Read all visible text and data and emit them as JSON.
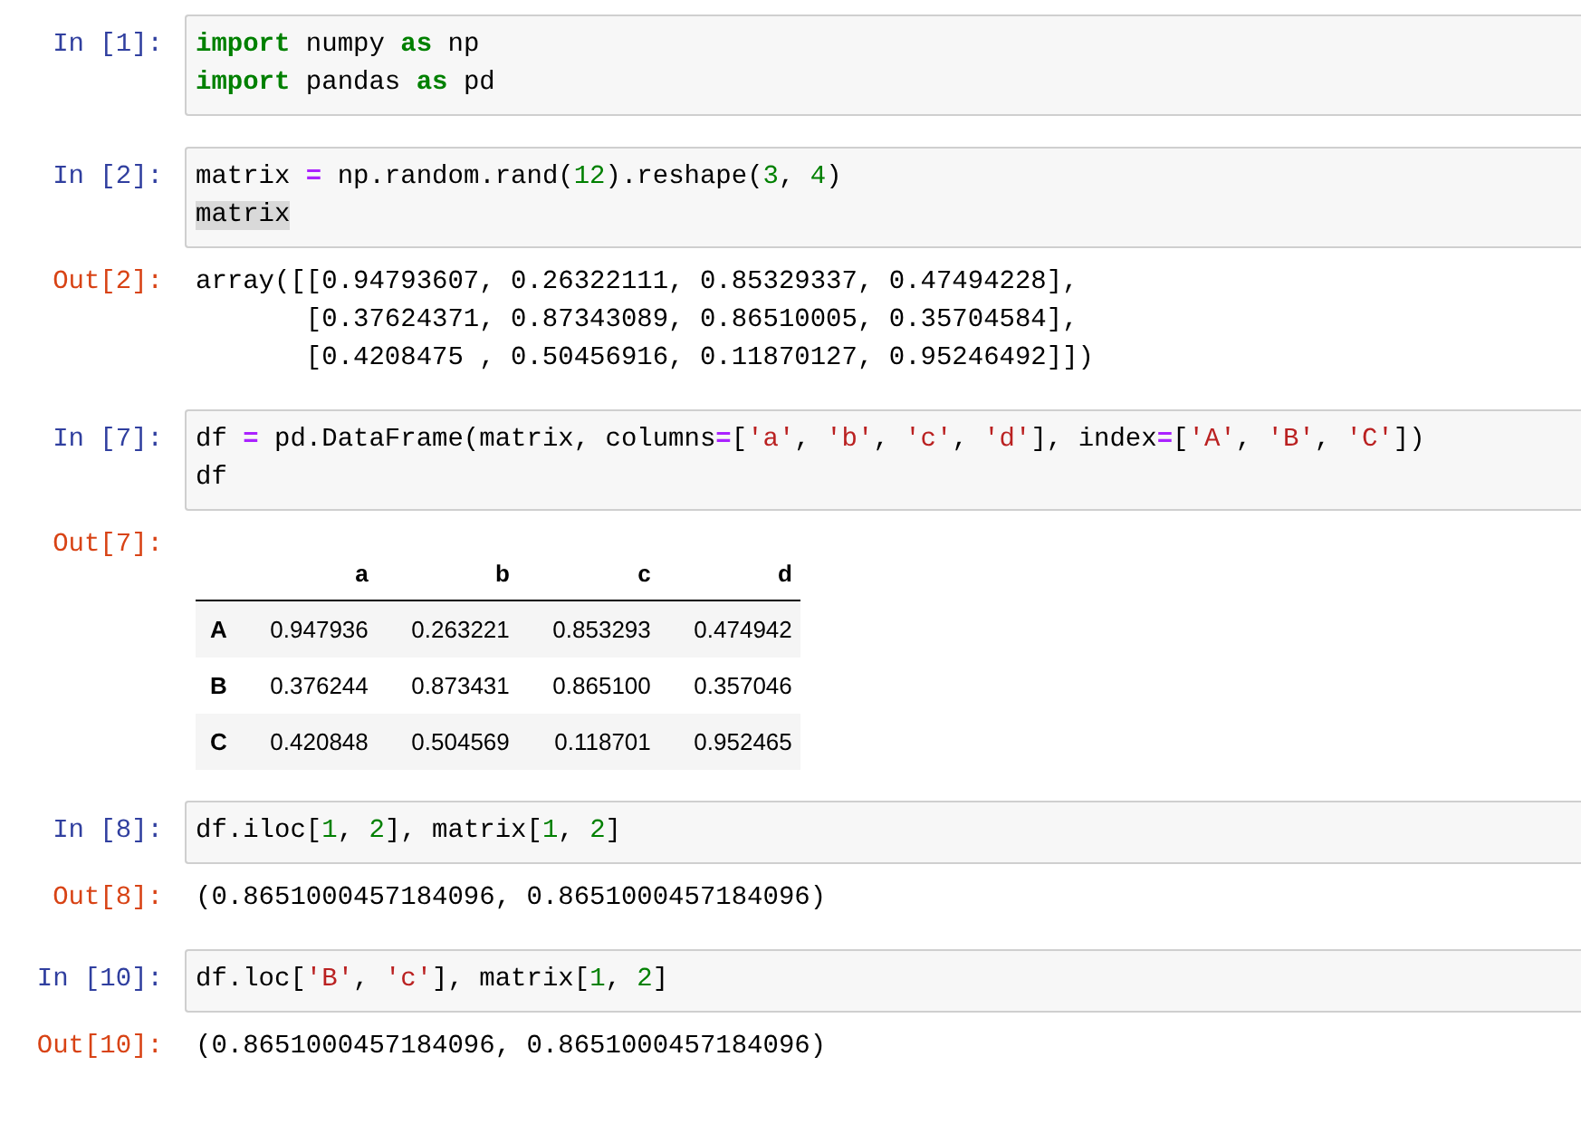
{
  "cells": [
    {
      "input_prompt": "In [1]:",
      "code": [
        [
          {
            "kind": "keyword",
            "text": "import"
          },
          {
            "kind": "plain",
            "text": " numpy "
          },
          {
            "kind": "keyword",
            "text": "as"
          },
          {
            "kind": "plain",
            "text": " np"
          }
        ],
        [
          {
            "kind": "keyword",
            "text": "import"
          },
          {
            "kind": "plain",
            "text": " pandas "
          },
          {
            "kind": "keyword",
            "text": "as"
          },
          {
            "kind": "plain",
            "text": " pd"
          }
        ]
      ]
    },
    {
      "input_prompt": "In [2]:",
      "code": [
        [
          {
            "kind": "plain",
            "text": "matrix "
          },
          {
            "kind": "operator",
            "text": "="
          },
          {
            "kind": "plain",
            "text": " np.random.rand("
          },
          {
            "kind": "number",
            "text": "12"
          },
          {
            "kind": "plain",
            "text": ").reshape("
          },
          {
            "kind": "number",
            "text": "3"
          },
          {
            "kind": "plain",
            "text": ", "
          },
          {
            "kind": "number",
            "text": "4"
          },
          {
            "kind": "plain",
            "text": ")"
          }
        ],
        [
          {
            "kind": "highlight",
            "text": "matrix"
          }
        ]
      ],
      "output": {
        "kind": "text",
        "prompt": "Out[2]:",
        "lines": [
          "array([[0.94793607, 0.26322111, 0.85329337, 0.47494228],",
          "       [0.37624371, 0.87343089, 0.86510005, 0.35704584],",
          "       [0.4208475 , 0.50456916, 0.11870127, 0.95246492]])"
        ]
      }
    },
    {
      "input_prompt": "In [7]:",
      "code": [
        [
          {
            "kind": "plain",
            "text": "df "
          },
          {
            "kind": "operator",
            "text": "="
          },
          {
            "kind": "plain",
            "text": " pd.DataFrame(matrix, columns"
          },
          {
            "kind": "operator",
            "text": "="
          },
          {
            "kind": "plain",
            "text": "["
          },
          {
            "kind": "string",
            "text": "'a'"
          },
          {
            "kind": "plain",
            "text": ", "
          },
          {
            "kind": "string",
            "text": "'b'"
          },
          {
            "kind": "plain",
            "text": ", "
          },
          {
            "kind": "string",
            "text": "'c'"
          },
          {
            "kind": "plain",
            "text": ", "
          },
          {
            "kind": "string",
            "text": "'d'"
          },
          {
            "kind": "plain",
            "text": "], index"
          },
          {
            "kind": "operator",
            "text": "="
          },
          {
            "kind": "plain",
            "text": "["
          },
          {
            "kind": "string",
            "text": "'A'"
          },
          {
            "kind": "plain",
            "text": ", "
          },
          {
            "kind": "string",
            "text": "'B'"
          },
          {
            "kind": "plain",
            "text": ", "
          },
          {
            "kind": "string",
            "text": "'C'"
          },
          {
            "kind": "plain",
            "text": "])"
          }
        ],
        [
          {
            "kind": "plain",
            "text": "df"
          }
        ]
      ],
      "output": {
        "kind": "table",
        "prompt": "Out[7]:",
        "columns": [
          "a",
          "b",
          "c",
          "d"
        ],
        "rows": [
          {
            "index": "A",
            "cells": [
              "0.947936",
              "0.263221",
              "0.853293",
              "0.474942"
            ]
          },
          {
            "index": "B",
            "cells": [
              "0.376244",
              "0.873431",
              "0.865100",
              "0.357046"
            ]
          },
          {
            "index": "C",
            "cells": [
              "0.420848",
              "0.504569",
              "0.118701",
              "0.952465"
            ]
          }
        ]
      }
    },
    {
      "input_prompt": "In [8]:",
      "code": [
        [
          {
            "kind": "plain",
            "text": "df.iloc["
          },
          {
            "kind": "number",
            "text": "1"
          },
          {
            "kind": "plain",
            "text": ", "
          },
          {
            "kind": "number",
            "text": "2"
          },
          {
            "kind": "plain",
            "text": "], matrix["
          },
          {
            "kind": "number",
            "text": "1"
          },
          {
            "kind": "plain",
            "text": ", "
          },
          {
            "kind": "number",
            "text": "2"
          },
          {
            "kind": "plain",
            "text": "]"
          }
        ]
      ],
      "output": {
        "kind": "text",
        "prompt": "Out[8]:",
        "lines": [
          "(0.8651000457184096, 0.8651000457184096)"
        ]
      }
    },
    {
      "input_prompt": "In [10]:",
      "code": [
        [
          {
            "kind": "plain",
            "text": "df.loc["
          },
          {
            "kind": "string",
            "text": "'B'"
          },
          {
            "kind": "plain",
            "text": ", "
          },
          {
            "kind": "string",
            "text": "'c'"
          },
          {
            "kind": "plain",
            "text": "], matrix["
          },
          {
            "kind": "number",
            "text": "1"
          },
          {
            "kind": "plain",
            "text": ", "
          },
          {
            "kind": "number",
            "text": "2"
          },
          {
            "kind": "plain",
            "text": "]"
          }
        ]
      ],
      "output": {
        "kind": "text",
        "prompt": "Out[10]:",
        "lines": [
          "(0.8651000457184096, 0.8651000457184096)"
        ]
      }
    }
  ]
}
